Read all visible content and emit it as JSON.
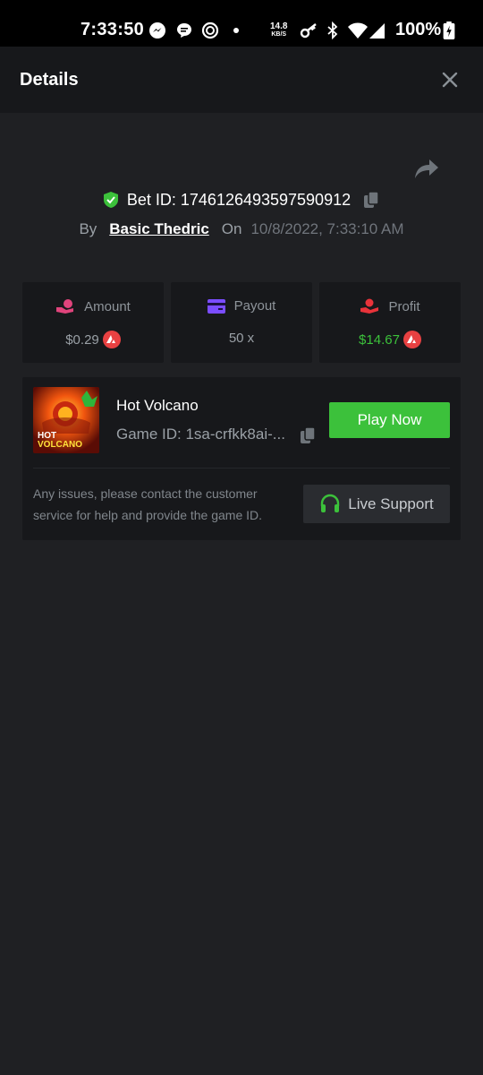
{
  "status_bar": {
    "time": "7:33:50",
    "net_speed_value": "14.8",
    "net_speed_unit": "KB/S",
    "battery": "100%"
  },
  "header": {
    "title": "Details"
  },
  "bet": {
    "id_label": "Bet ID: 1746126493597590912",
    "by_label": "By",
    "username": "Basic Thedric",
    "on_label": "On",
    "date": "10/8/2022, 7:33:10 AM"
  },
  "stats": {
    "amount_label": "Amount",
    "amount_value": "$0.29",
    "payout_label": "Payout",
    "payout_value": "50 x",
    "profit_label": "Profit",
    "profit_value": "$14.67"
  },
  "game": {
    "name": "Hot Volcano",
    "id_text": "Game ID: 1sa-crfkk8ai-...",
    "thumb_line1": "HOT",
    "thumb_line2": "VOLCANO",
    "play_label": "Play Now",
    "help_text": "Any issues, please contact the customer service for help and provide the game ID.",
    "support_label": "Live Support"
  },
  "colors": {
    "accent_green": "#3cc13b",
    "coin_red": "#e84142",
    "shield_green": "#3cc13b",
    "amount_icon_pink": "#e0447c",
    "payout_icon_purple": "#7b4dff",
    "profit_icon_red": "#e8333a"
  }
}
